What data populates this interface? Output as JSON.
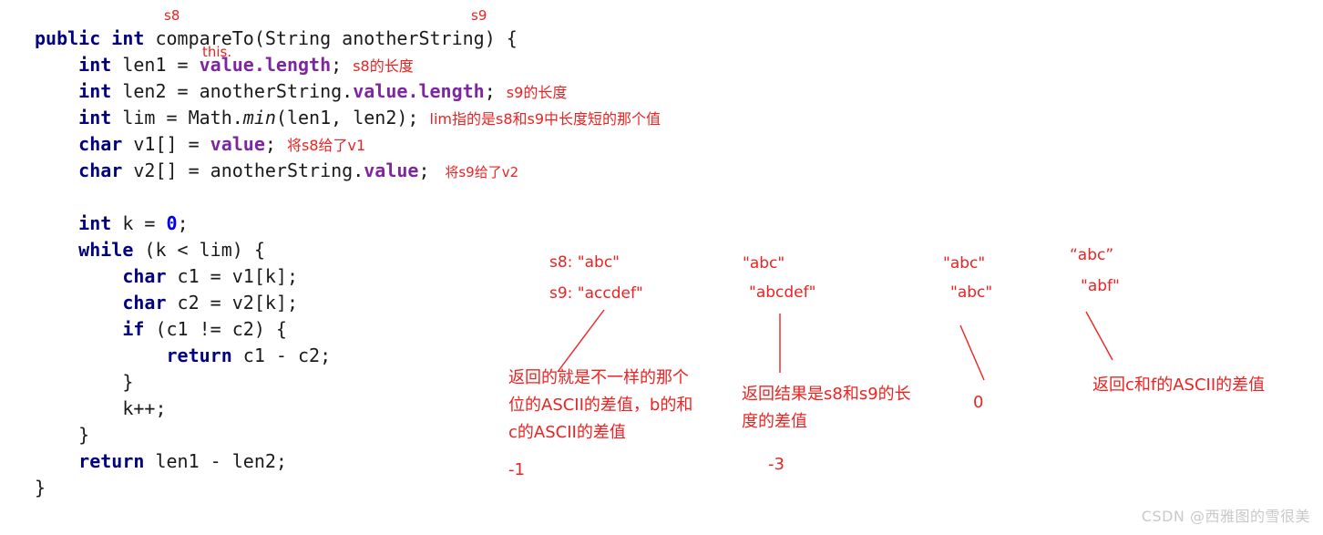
{
  "code": {
    "language": "java",
    "lines": [
      [
        {
          "t": "public",
          "c": "kw"
        },
        {
          "t": " ",
          "c": "plain"
        },
        {
          "t": "int",
          "c": "kw"
        },
        {
          "t": " compareTo(String anotherString) {",
          "c": "plain"
        }
      ],
      [
        {
          "t": "    ",
          "c": "plain"
        },
        {
          "t": "int",
          "c": "kw"
        },
        {
          "t": " len1 = ",
          "c": "plain"
        },
        {
          "t": "value.length",
          "c": "field"
        },
        {
          "t": "; ",
          "c": "plain"
        },
        {
          "t": "s8的长度",
          "c": "inline-note"
        }
      ],
      [
        {
          "t": "    ",
          "c": "plain"
        },
        {
          "t": "int",
          "c": "kw"
        },
        {
          "t": " len2 = anotherString.",
          "c": "plain"
        },
        {
          "t": "value.length",
          "c": "field"
        },
        {
          "t": "; ",
          "c": "plain"
        },
        {
          "t": "s9的长度",
          "c": "inline-note"
        }
      ],
      [
        {
          "t": "    ",
          "c": "plain"
        },
        {
          "t": "int",
          "c": "kw"
        },
        {
          "t": " lim = Math.",
          "c": "plain"
        },
        {
          "t": "min",
          "c": "ital"
        },
        {
          "t": "(len1, len2); ",
          "c": "plain"
        },
        {
          "t": "lim指的是s8和s9中长度短的那个值",
          "c": "inline-note"
        }
      ],
      [
        {
          "t": "    ",
          "c": "plain"
        },
        {
          "t": "char",
          "c": "kw"
        },
        {
          "t": " v1[] = ",
          "c": "plain"
        },
        {
          "t": "value",
          "c": "field"
        },
        {
          "t": "; ",
          "c": "plain"
        },
        {
          "t": "将s8给了v1",
          "c": "inline-note"
        }
      ],
      [
        {
          "t": "    ",
          "c": "plain"
        },
        {
          "t": "char",
          "c": "kw"
        },
        {
          "t": " v2[] = anotherString.",
          "c": "plain"
        },
        {
          "t": "value",
          "c": "field"
        },
        {
          "t": "; ",
          "c": "plain"
        },
        {
          "t": " 将s9给了v2",
          "c": "inline-note sm"
        }
      ],
      [],
      [
        {
          "t": "    ",
          "c": "plain"
        },
        {
          "t": "int",
          "c": "kw"
        },
        {
          "t": " k = ",
          "c": "plain"
        },
        {
          "t": "0",
          "c": "num"
        },
        {
          "t": ";",
          "c": "plain"
        }
      ],
      [
        {
          "t": "    ",
          "c": "plain"
        },
        {
          "t": "while",
          "c": "kw"
        },
        {
          "t": " (k < lim) {",
          "c": "plain"
        }
      ],
      [
        {
          "t": "        ",
          "c": "plain"
        },
        {
          "t": "char",
          "c": "kw"
        },
        {
          "t": " c1 = v1[k];",
          "c": "plain"
        }
      ],
      [
        {
          "t": "        ",
          "c": "plain"
        },
        {
          "t": "char",
          "c": "kw"
        },
        {
          "t": " c2 = v2[k];",
          "c": "plain"
        }
      ],
      [
        {
          "t": "        ",
          "c": "plain"
        },
        {
          "t": "if",
          "c": "kw"
        },
        {
          "t": " (c1 != c2) {",
          "c": "plain"
        }
      ],
      [
        {
          "t": "            ",
          "c": "plain"
        },
        {
          "t": "return",
          "c": "kw"
        },
        {
          "t": " c1 - c2;",
          "c": "plain"
        }
      ],
      [
        {
          "t": "        }",
          "c": "plain"
        }
      ],
      [
        {
          "t": "        k++;",
          "c": "plain"
        }
      ],
      [
        {
          "t": "    }",
          "c": "plain"
        }
      ],
      [
        {
          "t": "    ",
          "c": "plain"
        },
        {
          "t": "return",
          "c": "kw"
        },
        {
          "t": " len1 - len2;",
          "c": "plain"
        }
      ],
      [
        {
          "t": "}",
          "c": "plain"
        }
      ]
    ]
  },
  "annotations": {
    "param_s8": "s8",
    "param_s9": "s9",
    "this_overlay": "this.",
    "case1": {
      "line1": "s8: \"abc\"",
      "line2": "s9: \"accdef\"",
      "explain": "返回的就是不一样的那个位的ASCII的差值，b的和c的ASCII的差值",
      "result": "-1"
    },
    "case2": {
      "line1": "\"abc\"",
      "line2": "\"abcdef\"",
      "explain": "返回结果是s8和s9的长度的差值",
      "result": "-3"
    },
    "case3": {
      "line1": "\"abc\"",
      "line2": "\"abc\"",
      "result": "0"
    },
    "case4": {
      "line1": "“abc”",
      "line2": "\"abf\"",
      "explain": "返回c和f的ASCII的差值"
    }
  },
  "watermark": "CSDN @西雅图的雪很美",
  "colors": {
    "keyword": "#000080",
    "field": "#7d26a0",
    "number": "#0000ee",
    "annotation_red": "#ee2222",
    "code_text": "#1a1a1a",
    "background": "#ffffff",
    "watermark": "#c9c9c9"
  }
}
